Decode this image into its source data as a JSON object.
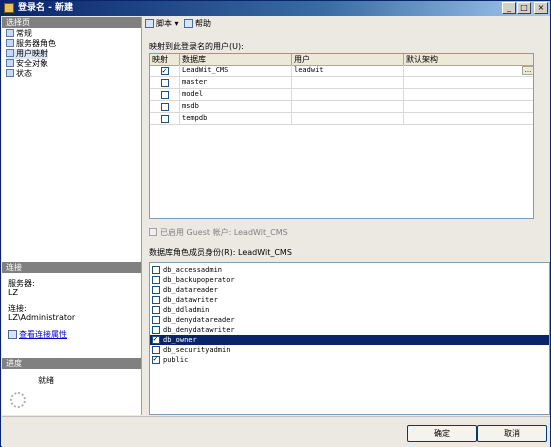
{
  "window": {
    "title": "登录名 - 新建"
  },
  "title_buttons": {
    "minimize": "_",
    "maximize": "□",
    "close": "×"
  },
  "left": {
    "select_page_header": "选择页",
    "pages": [
      {
        "label": "常规",
        "icon": "page-icon"
      },
      {
        "label": "服务器角色",
        "icon": "page-icon"
      },
      {
        "label": "用户映射",
        "icon": "page-icon",
        "selected": true
      },
      {
        "label": "安全对象",
        "icon": "page-icon"
      },
      {
        "label": "状态",
        "icon": "page-icon"
      }
    ],
    "connection_header": "连接",
    "server_label": "服务器:",
    "server_value": "LZ",
    "connection_label": "连接:",
    "connection_value": "LZ\\Administrator",
    "view_properties_link": "查看连接属性",
    "progress_header": "进度",
    "progress_status": "就绪"
  },
  "toolbar": {
    "script_label": "脚本",
    "help_label": "帮助"
  },
  "mapping": {
    "label": "映射到此登录名的用户(U):",
    "columns": [
      "映射",
      "数据库",
      "用户",
      "默认架构"
    ],
    "rows": [
      {
        "mapped": true,
        "database": "LeadWit_CMS",
        "user": "leadwit",
        "schema": ""
      },
      {
        "mapped": false,
        "database": "master",
        "user": "",
        "schema": ""
      },
      {
        "mapped": false,
        "database": "model",
        "user": "",
        "schema": ""
      },
      {
        "mapped": false,
        "database": "msdb",
        "user": "",
        "schema": ""
      },
      {
        "mapped": false,
        "database": "tempdb",
        "user": "",
        "schema": ""
      }
    ],
    "ellipsis": "..."
  },
  "guest": {
    "label": "已启用 Guest 帐户: LeadWit_CMS"
  },
  "roles": {
    "label": "数据库角色成员身份(R): LeadWit_CMS",
    "items": [
      {
        "name": "db_accessadmin",
        "checked": false
      },
      {
        "name": "db_backupoperator",
        "checked": false
      },
      {
        "name": "db_datareader",
        "checked": false
      },
      {
        "name": "db_datawriter",
        "checked": false
      },
      {
        "name": "db_ddladmin",
        "checked": false
      },
      {
        "name": "db_denydatareader",
        "checked": false
      },
      {
        "name": "db_denydatawriter",
        "checked": false
      },
      {
        "name": "db_owner",
        "checked": true,
        "selected": true
      },
      {
        "name": "db_securityadmin",
        "checked": false
      },
      {
        "name": "public",
        "checked": true
      }
    ]
  },
  "buttons": {
    "ok": "确定",
    "cancel": "取消"
  }
}
